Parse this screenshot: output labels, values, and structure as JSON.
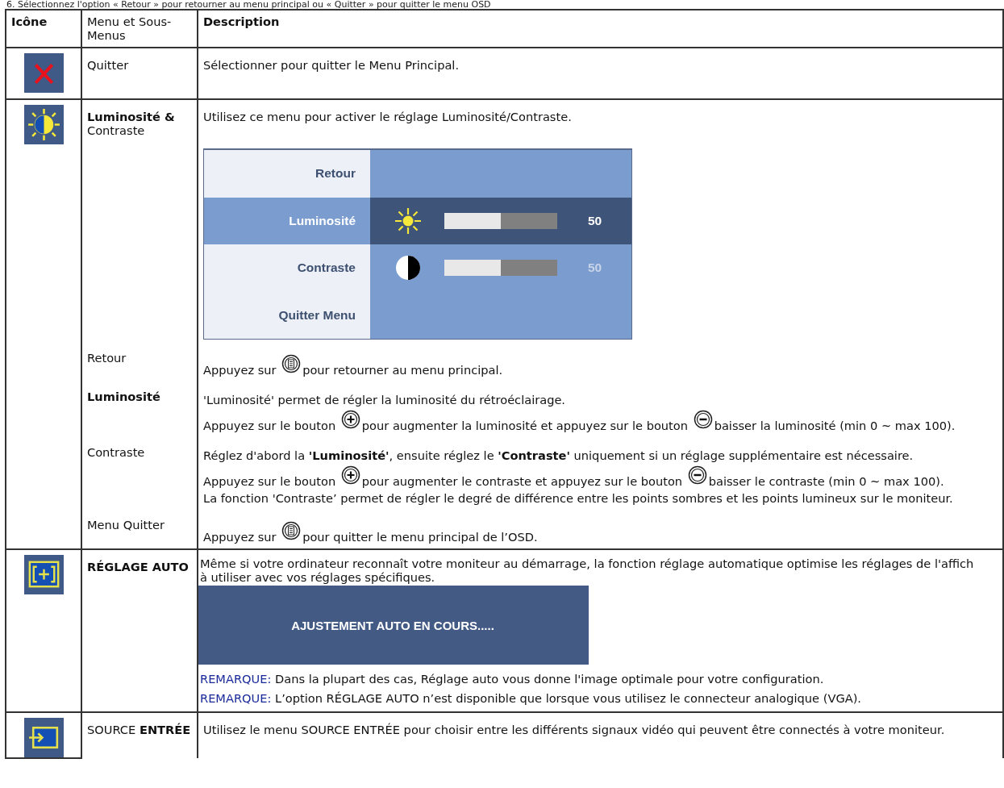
{
  "intro": "6.    Sélectionnez l'option « Retour » pour retourner au menu principal ou « Quitter » pour quitter le menu OSD",
  "table": {
    "columns": [
      "Icône",
      "Menu et Sous-Menus",
      "Description"
    ],
    "rows": [
      {
        "kind": "exit",
        "menu": "Quitter",
        "description": [
          {
            "kind": "text",
            "text": "Sélectionner pour quitter le Menu Principal."
          }
        ]
      },
      {
        "kind": "brightness",
        "menu": "**Luminosité &** Contraste",
        "description": [
          {
            "kind": "text",
            "text": "Utilisez ce menu pour activer le réglage Luminosité/Contraste."
          },
          {
            "kind": "osd",
            "items": [
              {
                "kind": "plain",
                "label": "Retour",
                "selected": false
              },
              {
                "kind": "brightness",
                "label": "Luminosité",
                "selected": true,
                "level": 0.5,
                "reading": "50"
              },
              {
                "kind": "contrast",
                "label": "Contraste",
                "selected": false,
                "level": 0.5,
                "reading": "50"
              },
              {
                "kind": "plain",
                "label": "Quitter Menu",
                "selected": false
              }
            ]
          }
        ],
        "sub_items": [
          {
            "label": "Retour",
            "lines": [
              [
                {
                  "kind": "text",
                  "text": "Appuyez sur "
                },
                {
                  "kind": "menu_button"
                },
                {
                  "kind": "text",
                  "text": "pour retourner au menu principal."
                }
              ]
            ]
          },
          {
            "label": "**Luminosité**",
            "lines": [
              [
                {
                  "kind": "text",
                  "text": "'Luminosité' permet de régler la luminosité du rétroéclairage."
                }
              ],
              [
                {
                  "kind": "text",
                  "text": "Appuyez sur le bouton "
                },
                {
                  "kind": "plus_button"
                },
                {
                  "kind": "text",
                  "text": "pour augmenter la luminosité et appuyez sur le bouton "
                },
                {
                  "kind": "minus_button"
                },
                {
                  "kind": "text",
                  "text": "baisser la luminosité (min 0 ~ max 100)."
                }
              ]
            ]
          },
          {
            "label": "Contraste",
            "lines": [
              [
                {
                  "kind": "text",
                  "text": "Réglez d'abord la **'Luminosité'**, ensuite réglez le **'Contraste'** uniquement si un réglage supplémentaire est nécessaire."
                }
              ],
              [
                {
                  "kind": "text",
                  "text": "Appuyez sur le bouton "
                },
                {
                  "kind": "plus_button"
                },
                {
                  "kind": "text",
                  "text": "pour augmenter le contraste et appuyez sur le bouton "
                },
                {
                  "kind": "minus_button"
                },
                {
                  "kind": "text",
                  "text": "baisser le contraste (min 0 ~ max 100)."
                }
              ],
              [
                {
                  "kind": "text",
                  "text": "La fonction 'Contraste’ permet de régler le degré de différence entre les points sombres et les points lumineux sur le moniteur."
                }
              ]
            ]
          },
          {
            "label": "Menu Quitter",
            "lines": [
              [
                {
                  "kind": "text",
                  "text": "Appuyez sur "
                },
                {
                  "kind": "menu_button"
                },
                {
                  "kind": "text",
                  "text": "pour quitter le menu principal de l’OSD."
                }
              ]
            ]
          }
        ]
      },
      {
        "kind": "auto",
        "menu": "**RÉGLAGE AUTO**",
        "description": [
          {
            "kind": "text",
            "text": "Même si votre ordinateur reconnaît votre moniteur au démarrage, la fonction réglage automatique optimise les réglages de l'affich"
          },
          {
            "kind": "text",
            "text": "à utiliser avec vos réglages spécifiques."
          },
          {
            "kind": "banner",
            "text": "AJUSTEMENT AUTO EN COURS....."
          },
          {
            "kind": "note",
            "label": "REMARQUE:",
            "text": "Dans la plupart des cas, Réglage auto vous donne l'image optimale pour votre configuration."
          },
          {
            "kind": "note",
            "label": "REMARQUE:",
            "text": "L’option RÉGLAGE AUTO n’est disponible que lorsque vous utilisez le connecteur analogique (VGA)."
          }
        ]
      },
      {
        "kind": "source",
        "menu": "SOURCE **ENTRÉE**",
        "description": [
          {
            "kind": "text",
            "text": "Utilisez le menu SOURCE ENTRÉE pour choisir entre les différents signaux vidéo qui peuvent être connectés à votre moniteur."
          }
        ]
      }
    ]
  }
}
